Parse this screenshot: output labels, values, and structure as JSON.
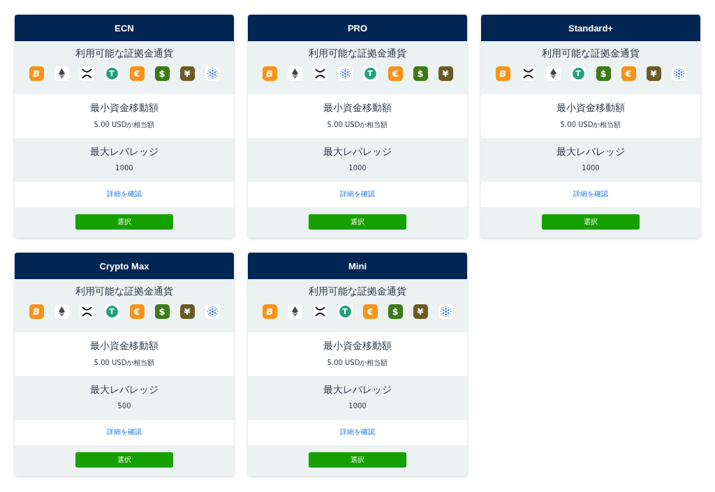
{
  "accounts": [
    {
      "name": "ECN",
      "currency_label": "利用可能な証拠金通貨",
      "currencies": [
        {
          "kind": "btc",
          "symbol": "B"
        },
        {
          "kind": "eth"
        },
        {
          "kind": "xrp"
        },
        {
          "kind": "usdt",
          "symbol": "T"
        },
        {
          "kind": "eur",
          "symbol": "€"
        },
        {
          "kind": "usd",
          "symbol": "$"
        },
        {
          "kind": "jpy",
          "symbol": "¥"
        },
        {
          "kind": "ada"
        }
      ],
      "min_label": "最小資金移動額",
      "min_value": "5.00 USDか相当額",
      "leverage_label": "最大レバレッジ",
      "leverage_value": "1000",
      "details_link": "詳細を確認",
      "select_button": "選択"
    },
    {
      "name": "PRO",
      "currency_label": "利用可能な証拠金通貨",
      "currencies": [
        {
          "kind": "btc",
          "symbol": "B"
        },
        {
          "kind": "eth"
        },
        {
          "kind": "xrp"
        },
        {
          "kind": "ada"
        },
        {
          "kind": "usdt",
          "symbol": "T"
        },
        {
          "kind": "eur",
          "symbol": "€"
        },
        {
          "kind": "usd",
          "symbol": "$"
        },
        {
          "kind": "jpy",
          "symbol": "¥"
        }
      ],
      "min_label": "最小資金移動額",
      "min_value": "5.00 USDか相当額",
      "leverage_label": "最大レバレッジ",
      "leverage_value": "1000",
      "details_link": "詳細を確認",
      "select_button": "選択"
    },
    {
      "name": "Standard+",
      "currency_label": "利用可能な証拠金通貨",
      "currencies": [
        {
          "kind": "btc",
          "symbol": "B"
        },
        {
          "kind": "xrp"
        },
        {
          "kind": "eth"
        },
        {
          "kind": "usdt",
          "symbol": "T"
        },
        {
          "kind": "usd",
          "symbol": "$"
        },
        {
          "kind": "eur",
          "symbol": "€"
        },
        {
          "kind": "jpy",
          "symbol": "¥"
        },
        {
          "kind": "ada"
        }
      ],
      "min_label": "最小資金移動額",
      "min_value": "5.00 USDか相当額",
      "leverage_label": "最大レバレッジ",
      "leverage_value": "1000",
      "details_link": "詳細を確認",
      "select_button": "選択"
    },
    {
      "name": "Crypto Max",
      "currency_label": "利用可能な証拠金通貨",
      "currencies": [
        {
          "kind": "btc",
          "symbol": "B"
        },
        {
          "kind": "eth"
        },
        {
          "kind": "xrp"
        },
        {
          "kind": "usdt",
          "symbol": "T"
        },
        {
          "kind": "eur",
          "symbol": "€"
        },
        {
          "kind": "usd",
          "symbol": "$"
        },
        {
          "kind": "jpy",
          "symbol": "¥"
        },
        {
          "kind": "ada"
        }
      ],
      "min_label": "最小資金移動額",
      "min_value": "5.00 USDか相当額",
      "leverage_label": "最大レバレッジ",
      "leverage_value": "500",
      "details_link": "詳細を確認",
      "select_button": "選択"
    },
    {
      "name": "Mini",
      "currency_label": "利用可能な証拠金通貨",
      "currencies": [
        {
          "kind": "btc",
          "symbol": "B"
        },
        {
          "kind": "eth"
        },
        {
          "kind": "xrp"
        },
        {
          "kind": "usdt",
          "symbol": "T"
        },
        {
          "kind": "eur",
          "symbol": "€"
        },
        {
          "kind": "usd",
          "symbol": "$"
        },
        {
          "kind": "jpy",
          "symbol": "¥"
        },
        {
          "kind": "ada"
        }
      ],
      "min_label": "最小資金移動額",
      "min_value": "5.00 USDか相当額",
      "leverage_label": "最大レバレッジ",
      "leverage_value": "1000",
      "details_link": "詳細を確認",
      "select_button": "選択"
    }
  ]
}
